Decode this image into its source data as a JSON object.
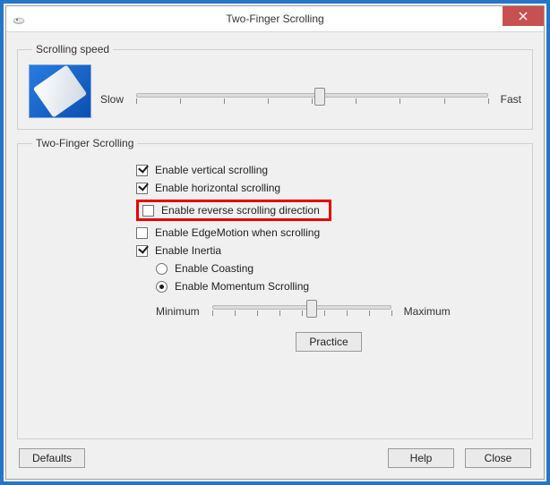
{
  "window": {
    "title": "Two-Finger Scrolling"
  },
  "speed": {
    "legend": "Scrolling speed",
    "min_label": "Slow",
    "max_label": "Fast",
    "ticks": 9,
    "value_pct": 52
  },
  "scroll": {
    "legend": "Two-Finger Scrolling",
    "vertical": {
      "label": "Enable vertical scrolling",
      "checked": true
    },
    "horizontal": {
      "label": "Enable horizontal scrolling",
      "checked": true
    },
    "reverse": {
      "label": "Enable reverse scrolling direction",
      "checked": false
    },
    "edgemotion": {
      "label": "Enable EdgeMotion when scrolling",
      "checked": false
    },
    "inertia": {
      "label": "Enable Inertia",
      "checked": true
    },
    "coasting": {
      "label": "Enable Coasting",
      "selected": false
    },
    "momentum": {
      "label": "Enable Momentum Scrolling",
      "selected": true
    },
    "inertia_slider": {
      "min_label": "Minimum",
      "max_label": "Maximum",
      "ticks": 9,
      "value_pct": 55
    },
    "practice_label": "Practice"
  },
  "buttons": {
    "defaults": "Defaults",
    "help": "Help",
    "close": "Close"
  }
}
